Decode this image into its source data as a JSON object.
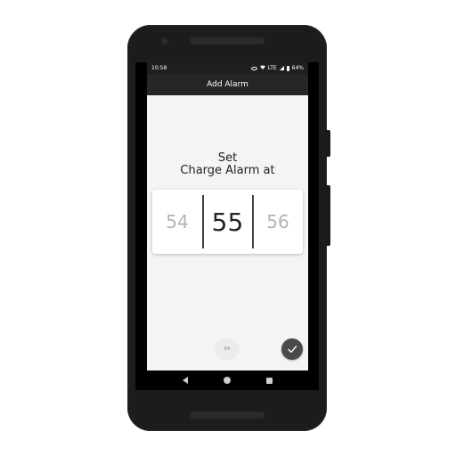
{
  "status_bar": {
    "time": "10:58",
    "network": "LTE",
    "battery": "64%",
    "icons": [
      "eye-icon",
      "wifi-icon",
      "signal-icon",
      "battery-icon"
    ]
  },
  "app_bar": {
    "title": "Add Alarm"
  },
  "main": {
    "heading_line1": "Set",
    "heading_line2": "Charge Alarm at",
    "picker": {
      "previous": "54",
      "current": "55",
      "next": "56"
    },
    "chip_label": "64",
    "confirm_icon": "check-icon"
  },
  "nav_bar": {
    "icons": [
      "back-icon",
      "home-icon",
      "recents-icon"
    ]
  },
  "colors": {
    "phone_body": "#1c1c1c",
    "app_bar": "#262626",
    "background": "#f4f4f4",
    "fab": "#4a4a4a"
  }
}
